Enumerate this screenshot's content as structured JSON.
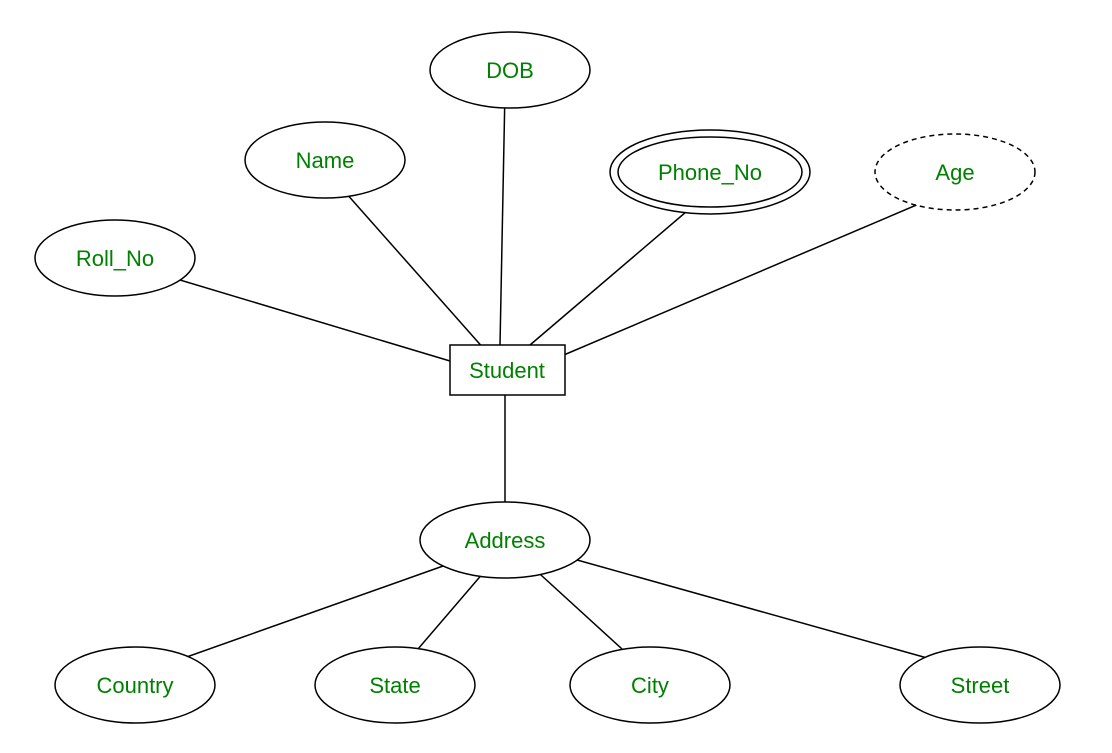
{
  "diagram": {
    "entity": {
      "label": "Student"
    },
    "attributes": {
      "roll_no": {
        "label": "Roll_No"
      },
      "name": {
        "label": "Name"
      },
      "dob": {
        "label": "DOB"
      },
      "phone_no": {
        "label": "Phone_No"
      },
      "age": {
        "label": "Age"
      },
      "address": {
        "label": "Address"
      },
      "country": {
        "label": "Country"
      },
      "state": {
        "label": "State"
      },
      "city": {
        "label": "City"
      },
      "street": {
        "label": "Street"
      }
    }
  }
}
